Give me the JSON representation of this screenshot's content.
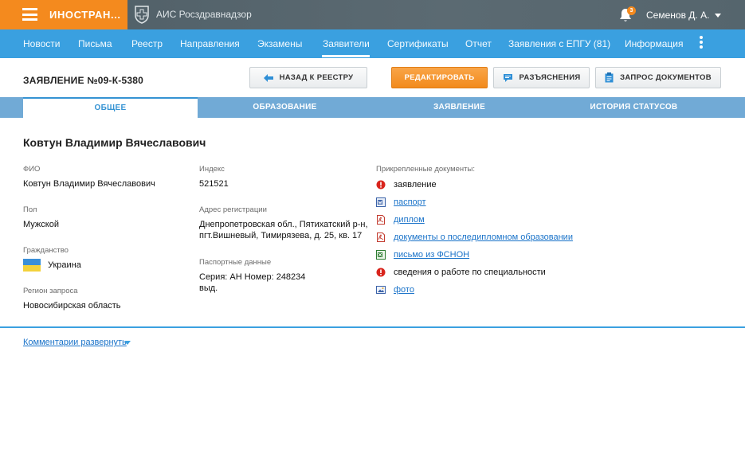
{
  "topbar": {
    "brand_title": "ИНОСТРАН...",
    "app_title": "АИС Росздравнадзор",
    "notifications_count": "3",
    "user_name": "Семенов Д. А."
  },
  "nav": {
    "items": [
      "Новости",
      "Письма",
      "Реестр",
      "Направления",
      "Экзамены",
      "Заявители",
      "Сертификаты",
      "Отчет",
      "Заявления с ЕПГУ (81)",
      "Информация"
    ],
    "active": "Заявители"
  },
  "header": {
    "title": "ЗАЯВЛЕНИЕ №09-К-5380",
    "back_label": "НАЗАД К РЕЕСТРУ",
    "edit_label": "РЕДАКТИРОВАТЬ",
    "clarifications_label": "РАЗЪЯСНЕНИЯ",
    "request_docs_label": "ЗАПРОС ДОКУМЕНТОВ"
  },
  "tabs": {
    "items": [
      "ОБЩЕЕ",
      "ОБРАЗОВАНИЕ",
      "ЗАЯВЛЕНИЕ",
      "ИСТОРИЯ СТАТУСОВ"
    ],
    "active": "ОБЩЕЕ"
  },
  "person": {
    "name": "Ковтун Владимир Вячеславович",
    "fio_label": "ФИО",
    "fio": "Ковтун Владимир Вячеславович",
    "gender_label": "Пол",
    "gender": "Мужской",
    "citizenship_label": "Гражданство",
    "citizenship": "Украина",
    "region_label": "Регион запроса",
    "region": "Новосибирская область",
    "index_label": "Индекс",
    "index": "521521",
    "address_label": "Адрес регистрации",
    "address_line1": "Днепропетровская обл., Пятихатский р-н,",
    "address_line2": "пгт.Вишневый, Тимирязева, д. 25, кв. 17",
    "passport_label": "Паспортные данные",
    "passport_line1": "Серия: АН Номер: 248234",
    "passport_line2": "выд."
  },
  "documents": {
    "label": "Прикрепленные документы:",
    "items": [
      {
        "name": "заявление",
        "icon": "missing-icon",
        "link": false
      },
      {
        "name": "паспорт",
        "icon": "word-doc-icon",
        "link": true
      },
      {
        "name": "диплом",
        "icon": "pdf-icon",
        "link": true
      },
      {
        "name": "документы о последипломном образовании",
        "icon": "pdf-icon",
        "link": true
      },
      {
        "name": "письмо из ФСНОН",
        "icon": "excel-icon",
        "link": true
      },
      {
        "name": "сведения о работе по специальности",
        "icon": "missing-icon",
        "link": false
      },
      {
        "name": "фото",
        "icon": "image-icon",
        "link": true
      }
    ]
  },
  "comments": {
    "label": "Комментарии развернуть"
  },
  "colors": {
    "accent_orange": "#f48a1e",
    "nav_blue": "#3aa0e0",
    "tab_blue": "#71aad6",
    "link_blue": "#1a73c9",
    "error_red": "#d9241c"
  }
}
